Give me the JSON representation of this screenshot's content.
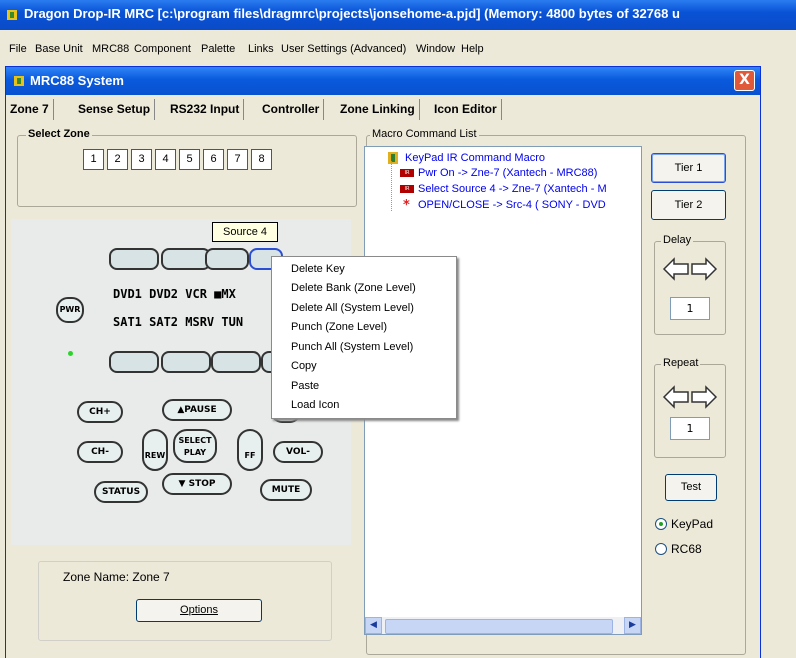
{
  "app": {
    "title": "Dragon Drop-IR MRC [c:\\program files\\dragmrc\\projects\\jonsehome-a.pjd] (Memory: 4800 bytes of 32768 u"
  },
  "menu": [
    "File",
    "Base Unit",
    "MRC88",
    "Component",
    "Palette",
    "Links",
    "User Settings (Advanced)",
    "Window",
    "Help"
  ],
  "window": {
    "title": "MRC88 System",
    "close_glyph": "X"
  },
  "tabs": [
    "Zone 7",
    "Sense Setup",
    "RS232 Input",
    "Controller",
    "Zone Linking",
    "Icon Editor"
  ],
  "select_zone": {
    "label": "Select Zone",
    "buttons": [
      "1",
      "2",
      "3",
      "4",
      "5",
      "6",
      "7",
      "8"
    ],
    "selected": "7"
  },
  "remote": {
    "tooltip": "Source 4",
    "pwr": "PWR",
    "row1": "DVD1 DVD2 VCR ■MX",
    "row2": "SAT1 SAT2 MSRV TUN",
    "ch_up": "CH+",
    "ch_down": "CH-",
    "pause": "▲PAUSE",
    "stop": "▼ STOP",
    "rew": "REW",
    "ff": "FF",
    "select1": "SELECT",
    "select2": "PLAY",
    "vol_down": "VOL-",
    "status": "STATUS",
    "mute": "MUTE"
  },
  "context_menu": [
    "Delete Key",
    "Delete Bank (Zone Level)",
    "Delete All (System Level)",
    "Punch (Zone Level)",
    "Punch All (System Level)",
    "Copy",
    "Paste",
    "Load Icon"
  ],
  "zone_name": {
    "text": "Zone Name: Zone 7",
    "options": "Options"
  },
  "macro": {
    "label": "Macro Command List",
    "root": "KeyPad IR Command Macro",
    "items": [
      {
        "badge": "IR",
        "text": "Pwr On -> Zne-7 (Xantech - MRC88)"
      },
      {
        "badge": "IR",
        "text": "Select Source 4 -> Zne-7 (Xantech - M"
      },
      {
        "badge": "*",
        "text": "OPEN/CLOSE -> Src-4 ( SONY - DVD"
      }
    ]
  },
  "side": {
    "tier1": "Tier 1",
    "tier2": "Tier 2",
    "delay": "Delay",
    "delay_value": "1",
    "repeat": "Repeat",
    "repeat_value": "1",
    "test": "Test",
    "radio": [
      "KeyPad",
      "RC68"
    ],
    "radio_selected": "KeyPad"
  },
  "colors": {
    "titlebar": "#0a58d8",
    "window_bg": "#ece9d8",
    "tree_text": "#0000ee",
    "accent": "#2b4fd4"
  }
}
